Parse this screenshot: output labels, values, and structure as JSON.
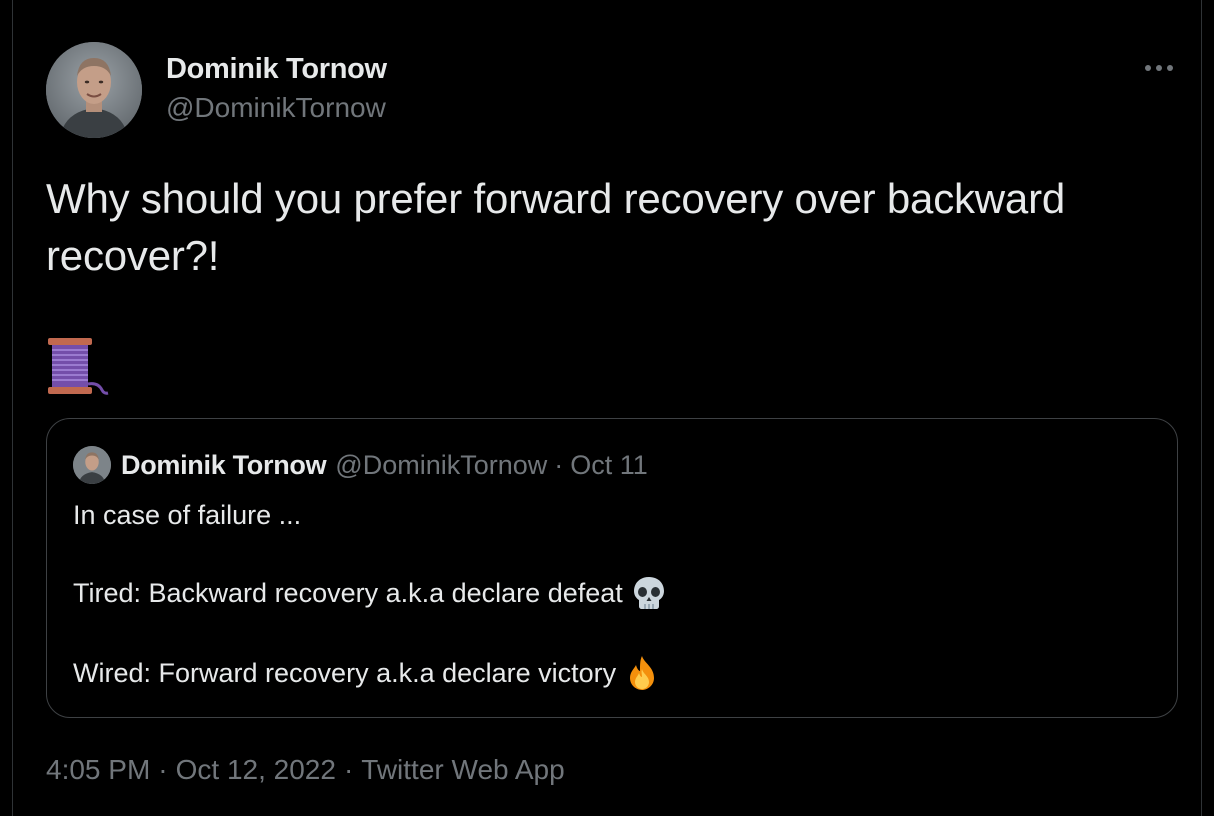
{
  "tweet": {
    "author_name": "Dominik Tornow",
    "author_handle": "@DominikTornow",
    "text": "Why should you prefer forward recovery over backward recover?!",
    "thread_emoji": "spool-of-thread-icon",
    "more_icon": "more-options-icon"
  },
  "quoted": {
    "author_name": "Dominik Tornow",
    "author_handle": "@DominikTornow",
    "separator": "·",
    "date": "Oct 11",
    "lines": [
      "In case of failure ...",
      "Tired: Backward recovery a.k.a declare defeat",
      "Wired: Forward recovery a.k.a declare victory"
    ],
    "line_emojis": [
      "",
      "skull-icon",
      "fire-icon"
    ]
  },
  "footer": {
    "time": "4:05 PM",
    "separator": "·",
    "date": "Oct 12, 2022",
    "source": "Twitter Web App"
  },
  "colors": {
    "background": "#000000",
    "primary_text": "#e7e9ea",
    "secondary_text": "#71767b",
    "border": "#3e4144"
  }
}
